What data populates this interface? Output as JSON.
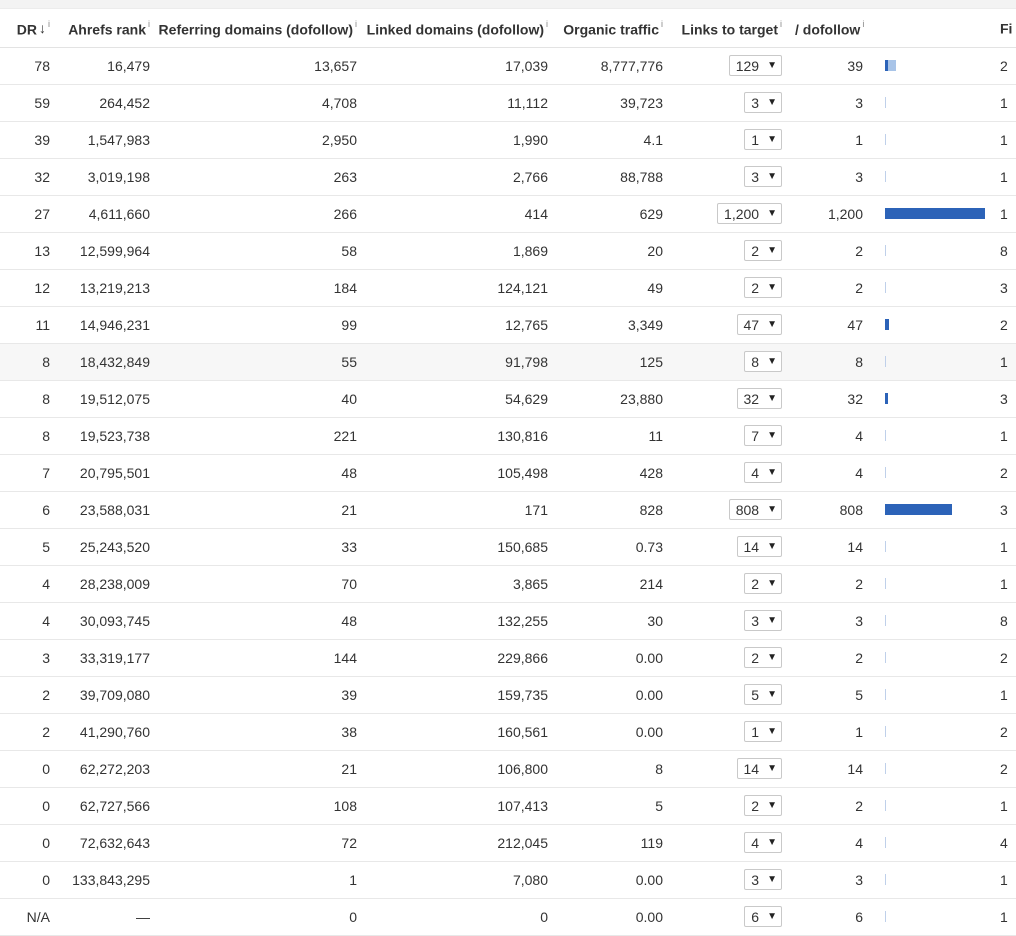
{
  "headers": {
    "dr": "DR",
    "dr_sort": "↓",
    "ahrefs_rank": "Ahrefs rank",
    "ref_domains": "Referring domains (dofollow)",
    "linked_domains": "Linked domains (dofollow)",
    "organic_traffic": "Organic traffic",
    "links_to_target": "Links to target",
    "dofollow": "/ dofollow",
    "cut_col": "Fi",
    "info": "i"
  },
  "rows": [
    {
      "dr": "78",
      "rank": "16,479",
      "ref": "13,657",
      "linked": "17,039",
      "traffic": "8,777,776",
      "links": "129",
      "dofollow": "39",
      "dofollow_fraction": 0.0325,
      "links_fraction": 0.1075,
      "cut": "2"
    },
    {
      "dr": "59",
      "rank": "264,452",
      "ref": "4,708",
      "linked": "11,112",
      "traffic": "39,723",
      "links": "3",
      "dofollow": "3",
      "dofollow_fraction": 0.0025,
      "links_fraction": 0.0025,
      "cut": "1"
    },
    {
      "dr": "39",
      "rank": "1,547,983",
      "ref": "2,950",
      "linked": "1,990",
      "traffic": "4.1",
      "links": "1",
      "dofollow": "1",
      "dofollow_fraction": 0.0008,
      "links_fraction": 0.0008,
      "cut": "1"
    },
    {
      "dr": "32",
      "rank": "3,019,198",
      "ref": "263",
      "linked": "2,766",
      "traffic": "88,788",
      "links": "3",
      "dofollow": "3",
      "dofollow_fraction": 0.0025,
      "links_fraction": 0.0025,
      "cut": "1"
    },
    {
      "dr": "27",
      "rank": "4,611,660",
      "ref": "266",
      "linked": "414",
      "traffic": "629",
      "links": "1,200",
      "dofollow": "1,200",
      "dofollow_fraction": 1.0,
      "links_fraction": 1.0,
      "cut": "1"
    },
    {
      "dr": "13",
      "rank": "12,599,964",
      "ref": "58",
      "linked": "1,869",
      "traffic": "20",
      "links": "2",
      "dofollow": "2",
      "dofollow_fraction": 0.0017,
      "links_fraction": 0.0017,
      "cut": "8"
    },
    {
      "dr": "12",
      "rank": "13,219,213",
      "ref": "184",
      "linked": "124,121",
      "traffic": "49",
      "links": "2",
      "dofollow": "2",
      "dofollow_fraction": 0.0017,
      "links_fraction": 0.0017,
      "cut": "3"
    },
    {
      "dr": "11",
      "rank": "14,946,231",
      "ref": "99",
      "linked": "12,765",
      "traffic": "3,349",
      "links": "47",
      "dofollow": "47",
      "dofollow_fraction": 0.039,
      "links_fraction": 0.039,
      "cut": "2"
    },
    {
      "dr": "8",
      "rank": "18,432,849",
      "ref": "55",
      "linked": "91,798",
      "traffic": "125",
      "links": "8",
      "dofollow": "8",
      "dofollow_fraction": 0.0067,
      "links_fraction": 0.0067,
      "cut": "1",
      "highlight": true
    },
    {
      "dr": "8",
      "rank": "19,512,075",
      "ref": "40",
      "linked": "54,629",
      "traffic": "23,880",
      "links": "32",
      "dofollow": "32",
      "dofollow_fraction": 0.0267,
      "links_fraction": 0.0267,
      "cut": "3"
    },
    {
      "dr": "8",
      "rank": "19,523,738",
      "ref": "221",
      "linked": "130,816",
      "traffic": "11",
      "links": "7",
      "dofollow": "4",
      "dofollow_fraction": 0.0033,
      "links_fraction": 0.0058,
      "cut": "1"
    },
    {
      "dr": "7",
      "rank": "20,795,501",
      "ref": "48",
      "linked": "105,498",
      "traffic": "428",
      "links": "4",
      "dofollow": "4",
      "dofollow_fraction": 0.0033,
      "links_fraction": 0.0033,
      "cut": "2"
    },
    {
      "dr": "6",
      "rank": "23,588,031",
      "ref": "21",
      "linked": "171",
      "traffic": "828",
      "links": "808",
      "dofollow": "808",
      "dofollow_fraction": 0.673,
      "links_fraction": 0.673,
      "cut": "3"
    },
    {
      "dr": "5",
      "rank": "25,243,520",
      "ref": "33",
      "linked": "150,685",
      "traffic": "0.73",
      "links": "14",
      "dofollow": "14",
      "dofollow_fraction": 0.0117,
      "links_fraction": 0.0117,
      "cut": "1"
    },
    {
      "dr": "4",
      "rank": "28,238,009",
      "ref": "70",
      "linked": "3,865",
      "traffic": "214",
      "links": "2",
      "dofollow": "2",
      "dofollow_fraction": 0.0017,
      "links_fraction": 0.0017,
      "cut": "1"
    },
    {
      "dr": "4",
      "rank": "30,093,745",
      "ref": "48",
      "linked": "132,255",
      "traffic": "30",
      "links": "3",
      "dofollow": "3",
      "dofollow_fraction": 0.0025,
      "links_fraction": 0.0025,
      "cut": "8"
    },
    {
      "dr": "3",
      "rank": "33,319,177",
      "ref": "144",
      "linked": "229,866",
      "traffic": "0.00",
      "links": "2",
      "dofollow": "2",
      "dofollow_fraction": 0.0017,
      "links_fraction": 0.0017,
      "cut": "2"
    },
    {
      "dr": "2",
      "rank": "39,709,080",
      "ref": "39",
      "linked": "159,735",
      "traffic": "0.00",
      "links": "5",
      "dofollow": "5",
      "dofollow_fraction": 0.0042,
      "links_fraction": 0.0042,
      "cut": "1"
    },
    {
      "dr": "2",
      "rank": "41,290,760",
      "ref": "38",
      "linked": "160,561",
      "traffic": "0.00",
      "links": "1",
      "dofollow": "1",
      "dofollow_fraction": 0.0008,
      "links_fraction": 0.0008,
      "cut": "2"
    },
    {
      "dr": "0",
      "rank": "62,272,203",
      "ref": "21",
      "linked": "106,800",
      "traffic": "8",
      "links": "14",
      "dofollow": "14",
      "dofollow_fraction": 0.0117,
      "links_fraction": 0.0117,
      "cut": "2"
    },
    {
      "dr": "0",
      "rank": "62,727,566",
      "ref": "108",
      "linked": "107,413",
      "traffic": "5",
      "links": "2",
      "dofollow": "2",
      "dofollow_fraction": 0.0017,
      "links_fraction": 0.0017,
      "cut": "1"
    },
    {
      "dr": "0",
      "rank": "72,632,643",
      "ref": "72",
      "linked": "212,045",
      "traffic": "119",
      "links": "4",
      "dofollow": "4",
      "dofollow_fraction": 0.0033,
      "links_fraction": 0.0033,
      "cut": "4"
    },
    {
      "dr": "0",
      "rank": "133,843,295",
      "ref": "1",
      "linked": "7,080",
      "traffic": "0.00",
      "links": "3",
      "dofollow": "3",
      "dofollow_fraction": 0.0025,
      "links_fraction": 0.0025,
      "cut": "1"
    },
    {
      "dr": "N/A",
      "rank": "—",
      "ref": "0",
      "linked": "0",
      "traffic": "0.00",
      "links": "6",
      "dofollow": "6",
      "dofollow_fraction": 0.005,
      "links_fraction": 0.005,
      "cut": "1"
    }
  ],
  "colors": {
    "bar_dofollow": "#2c63b8",
    "bar_total": "#a8c4e8",
    "row_highlight": "#f7f7f7",
    "border": "#e8e8e8"
  }
}
